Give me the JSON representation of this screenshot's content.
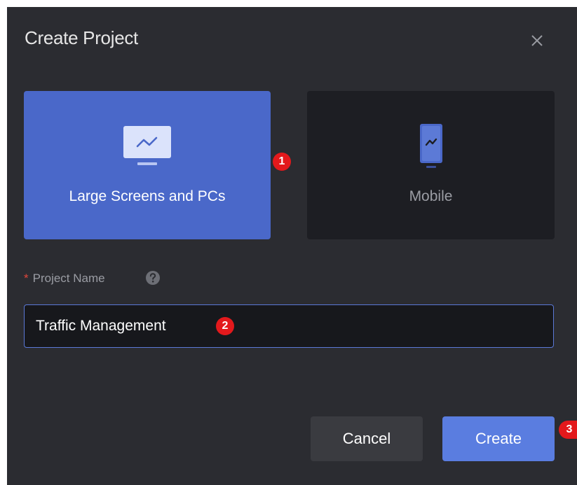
{
  "dialog": {
    "title": "Create Project",
    "close_icon": "close-icon"
  },
  "project_types": [
    {
      "label": "Large Screens and PCs",
      "icon": "monitor-chart-icon",
      "selected": true
    },
    {
      "label": "Mobile",
      "icon": "mobile-phone-icon",
      "selected": false
    }
  ],
  "form": {
    "required_marker": "*",
    "name_label": "Project Name",
    "help_icon": "question-circle-icon",
    "name_value": "Traffic Management"
  },
  "buttons": {
    "cancel": "Cancel",
    "create": "Create"
  },
  "step_badges": [
    "1",
    "2",
    "3"
  ],
  "colors": {
    "dialog_bg": "#2b2c31",
    "selected_card": "#4a68c9",
    "unselected_card": "#1d1e23",
    "primary_button": "#5a7de0",
    "badge": "#e3191c",
    "input_border": "#5b79d7"
  }
}
